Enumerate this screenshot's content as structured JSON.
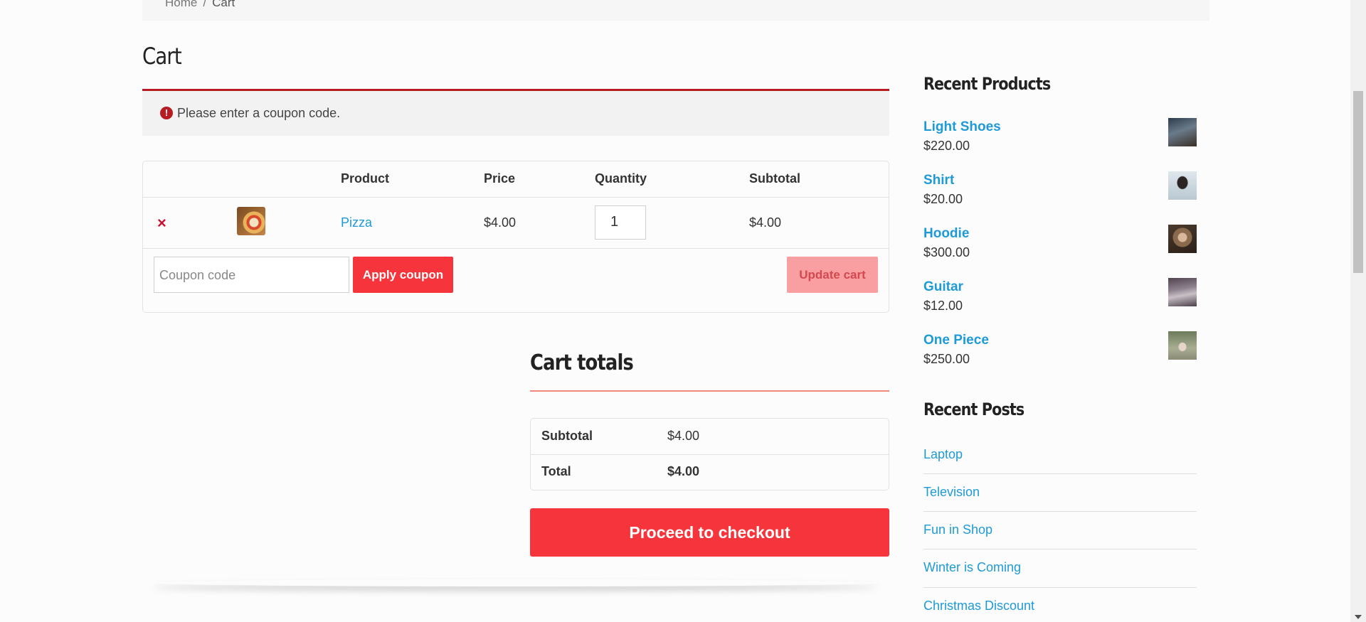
{
  "breadcrumb": {
    "home": "Home",
    "separator": "/",
    "current": "Cart"
  },
  "page": {
    "title": "Cart"
  },
  "notice": {
    "icon": "exclamation-icon",
    "text": "Please enter a coupon code.",
    "color": "#b81c23"
  },
  "cart": {
    "headers": {
      "product": "Product",
      "price": "Price",
      "quantity": "Quantity",
      "subtotal": "Subtotal"
    },
    "items": [
      {
        "remove": "×",
        "name": "Pizza",
        "price": "$4.00",
        "quantity": "1",
        "subtotal": "$4.00"
      }
    ],
    "coupon_placeholder": "Coupon code",
    "apply_label": "Apply coupon",
    "update_label": "Update cart"
  },
  "totals": {
    "title": "Cart totals",
    "subtotal_label": "Subtotal",
    "subtotal_value": "$4.00",
    "total_label": "Total",
    "total_value": "$4.00",
    "checkout_label": "Proceed to checkout"
  },
  "sidebar": {
    "recent_products_title": "Recent Products",
    "products": [
      {
        "name": "Light Shoes",
        "price": "$220.00"
      },
      {
        "name": "Shirt",
        "price": "$20.00"
      },
      {
        "name": "Hoodie",
        "price": "$300.00"
      },
      {
        "name": "Guitar",
        "price": "$12.00"
      },
      {
        "name": "One Piece",
        "price": "$250.00"
      }
    ],
    "recent_posts_title": "Recent Posts",
    "posts": [
      "Laptop",
      "Television",
      "Fun in Shop",
      "Winter is Coming",
      "Christmas Discount"
    ]
  },
  "colors": {
    "accent": "#f6343c",
    "link": "#1e9ad6",
    "notice_border": "#b81c23"
  }
}
